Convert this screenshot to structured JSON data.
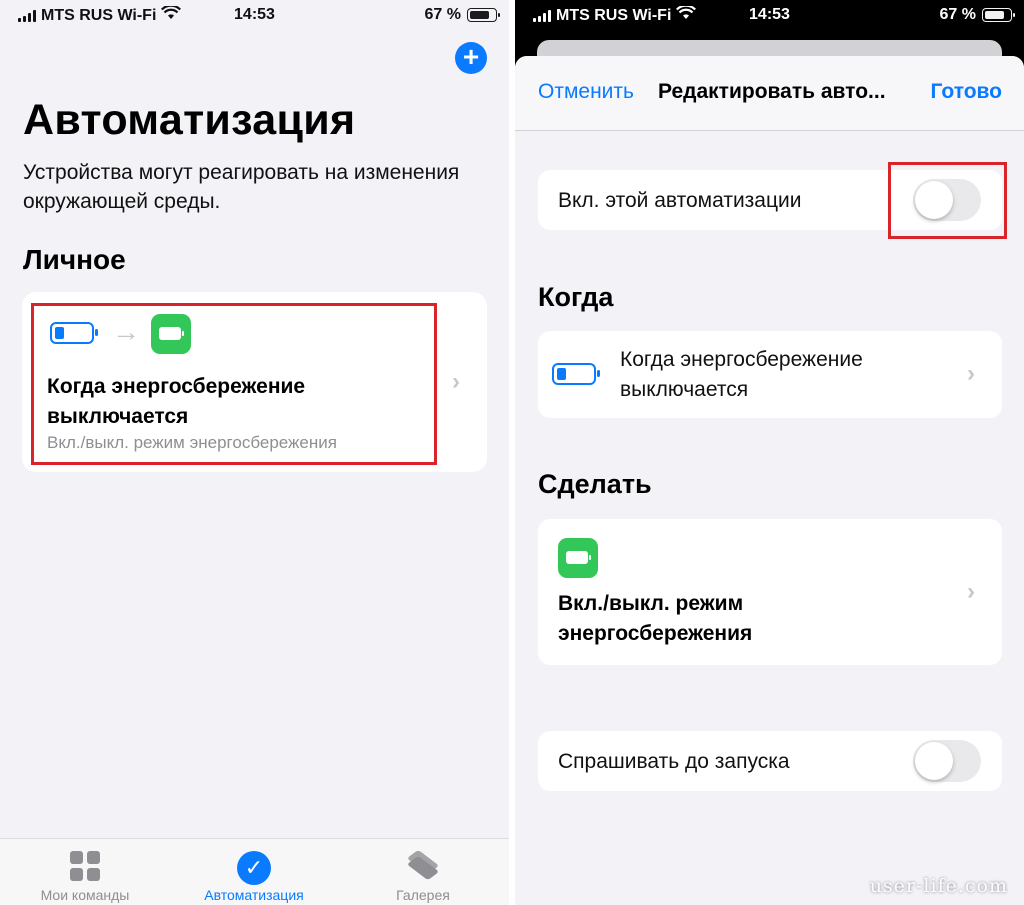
{
  "status_bar": {
    "carrier": "MTS RUS Wi-Fi",
    "time": "14:53",
    "battery": "67 %",
    "battery_level": 0.67
  },
  "left": {
    "add_icon": "plus-icon",
    "title": "Автоматизация",
    "subtitle": "Устройства могут реагировать на изменения окружающей среды.",
    "section_title": "Личное",
    "card": {
      "trigger_icon": "low-battery-icon",
      "arrow_icon": "arrow-right-icon",
      "action_icon": "green-battery-icon",
      "title": "Когда энергосбережение выключается",
      "subtitle": "Вкл./выкл. режим энергосбережения"
    },
    "tabs": [
      {
        "label": "Мои команды",
        "icon": "grid-icon",
        "active": false
      },
      {
        "label": "Автоматизация",
        "icon": "checkmark-circle-icon",
        "active": true
      },
      {
        "label": "Галерея",
        "icon": "layers-icon",
        "active": false
      }
    ]
  },
  "right": {
    "nav": {
      "cancel": "Отменить",
      "title": "Редактировать авто...",
      "done": "Готово"
    },
    "enable_row": {
      "label": "Вкл. этой автоматизации",
      "enabled": false
    },
    "when_section": "Когда",
    "when_row": {
      "icon": "low-battery-icon",
      "text": "Когда энергосбережение выключается"
    },
    "do_section": "Сделать",
    "do_row": {
      "icon": "green-battery-icon",
      "text": "Вкл./выкл. режим энергосбережения"
    },
    "ask_row": {
      "label": "Спрашивать до запуска",
      "enabled": false
    }
  },
  "colors": {
    "accent": "#0a7aff",
    "highlight": "#d9252a",
    "green": "#33c759"
  },
  "watermark": "user-life.com"
}
